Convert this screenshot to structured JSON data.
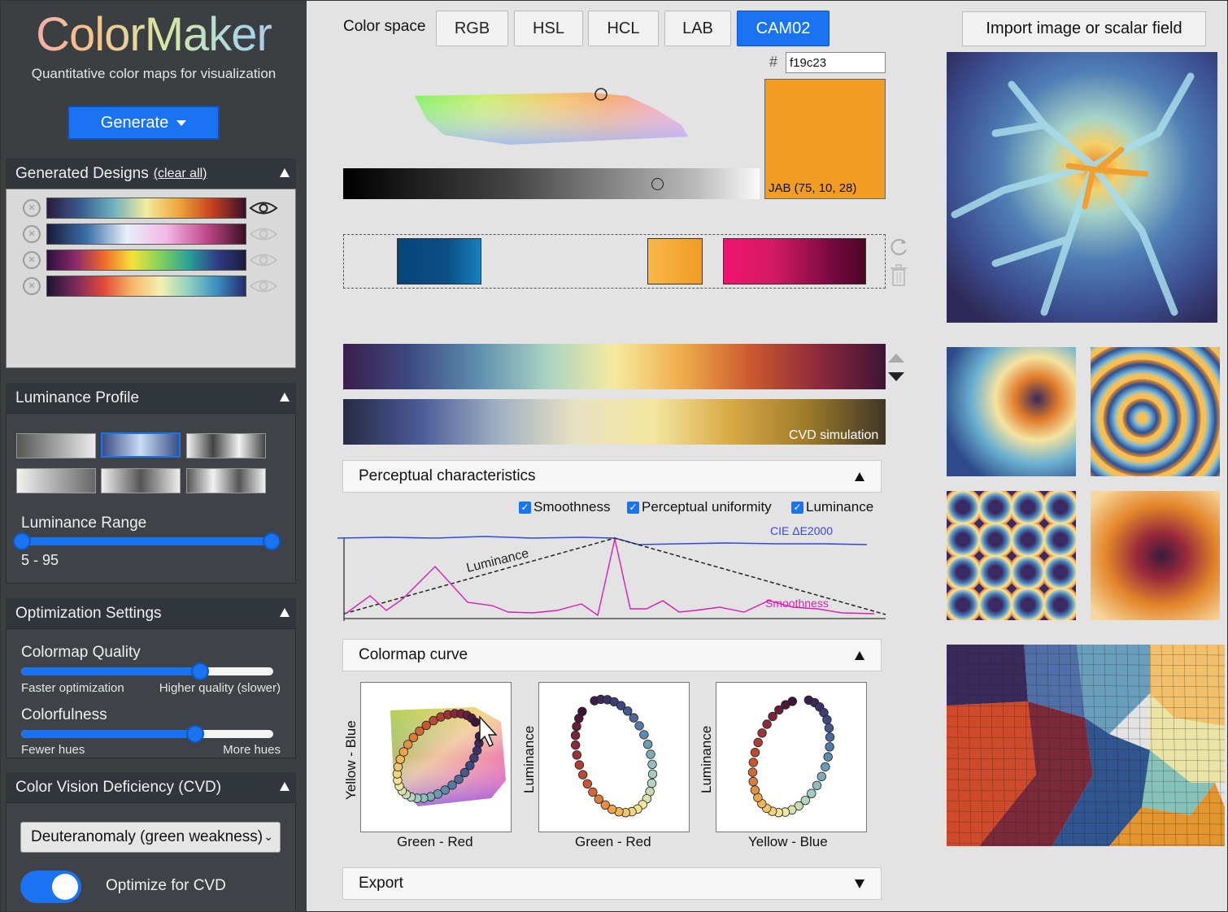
{
  "app": {
    "logo": "ColorMaker",
    "tagline": "Quantitative color maps for visualization",
    "generate_label": "Generate"
  },
  "generated_designs": {
    "title": "Generated Designs",
    "clear_label": "(clear all)",
    "remove_glyph": "×",
    "items": [
      {
        "stops": [
          "#2b1a3d",
          "#3a5a8e",
          "#6fb1c1",
          "#f1ec9b",
          "#f0a33a",
          "#c4401e",
          "#3b0f2b"
        ],
        "visible": true
      },
      {
        "stops": [
          "#191a3a",
          "#3c6fa8",
          "#e8f0f8",
          "#f2b8e6",
          "#c24a8b",
          "#3a0f23"
        ],
        "visible": false
      },
      {
        "stops": [
          "#2a123d",
          "#8a2a6b",
          "#ee6a2a",
          "#f4e33a",
          "#7fd25a",
          "#2aa09a",
          "#2d3e86",
          "#1c1a3a"
        ],
        "visible": false
      },
      {
        "stops": [
          "#1c1434",
          "#7a2a5a",
          "#e04a3a",
          "#f7b76a",
          "#f3f1b0",
          "#8fd0c0",
          "#3a8ec0",
          "#262a6a"
        ],
        "visible": false
      }
    ]
  },
  "luminance_profile": {
    "title": "Luminance Profile",
    "range_label": "Luminance Range",
    "range_value": "5 - 95",
    "range_min": 5,
    "range_max": 95
  },
  "optimization": {
    "title": "Optimization Settings",
    "quality_label": "Colormap Quality",
    "quality_min_label": "Faster optimization",
    "quality_max_label": "Higher quality (slower)",
    "quality_level": 0.71,
    "colorfulness_label": "Colorfulness",
    "colorfulness_min_label": "Fewer hues",
    "colorfulness_max_label": "More hues",
    "colorfulness_level": 0.69
  },
  "cvd": {
    "title": "Color Vision Deficiency (CVD)",
    "selected": "Deuteranomaly (green weakness)",
    "optimize_label": "Optimize for CVD",
    "optimize_on": true
  },
  "color_space": {
    "label": "Color space",
    "options": [
      "RGB",
      "HSL",
      "HCL",
      "LAB",
      "CAM02"
    ],
    "selected": "CAM02"
  },
  "picker": {
    "hash": "#",
    "hex_value": "f19c23",
    "swatch_color": "#f19c23",
    "jab_label": "JAB (75, 10, 28)"
  },
  "swatches": [
    "#0a4f86",
    "#f19c23",
    "#d41a62"
  ],
  "colormap": {
    "stops": [
      "#3c1e4a",
      "#3d4a82",
      "#5f8fb0",
      "#a9d2c4",
      "#f6eb9e",
      "#f0ab4c",
      "#cb5a2f",
      "#8e2a3b",
      "#3e1437"
    ],
    "cvd_stops": [
      "#272b45",
      "#4b5b99",
      "#9fb0c4",
      "#e8e2c2",
      "#f4e6a0",
      "#d9a945",
      "#9d7a2a",
      "#3f3626"
    ],
    "cvd_label": "CVD simulation"
  },
  "perceptual": {
    "title": "Perceptual characteristics",
    "checks": [
      "Smoothness",
      "Perceptual uniformity",
      "Luminance"
    ],
    "check_glyph": "✓",
    "labels": {
      "cie": "CIE ΔE2000",
      "luminance": "Luminance",
      "smoothness": "Smoothness"
    }
  },
  "curve": {
    "title": "Colormap curve",
    "plots": [
      {
        "x": "Green - Red",
        "y": "Yellow - Blue"
      },
      {
        "x": "Green - Red",
        "y": "Luminance"
      },
      {
        "x": "Yellow - Blue",
        "y": "Luminance"
      }
    ]
  },
  "export_title": "Export",
  "import_label": "Import image or scalar field",
  "colors": {
    "accent": "#1a73f0",
    "sidebar": "#3c3f42",
    "panel_header": "#31363c"
  }
}
